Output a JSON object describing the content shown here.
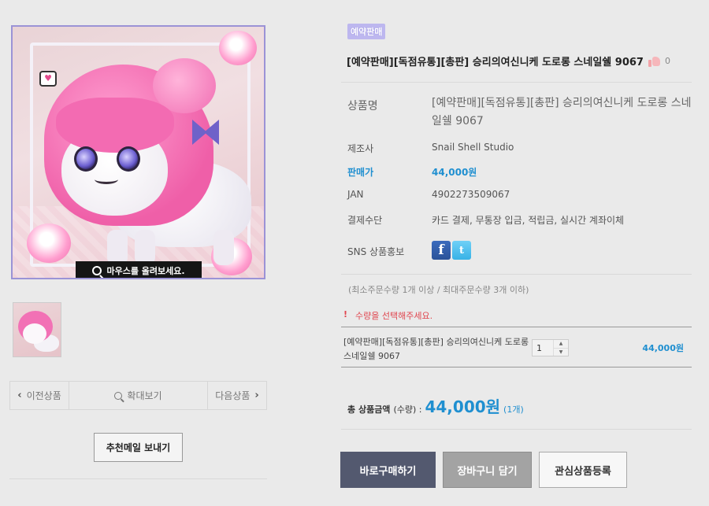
{
  "image": {
    "hover_hint": "마우스를 올려보세요."
  },
  "nav": {
    "prev": "이전상품",
    "zoom": "확대보기",
    "next": "다음상품"
  },
  "recommend_button": "추천메일 보내기",
  "product": {
    "badge": "예약판매",
    "title": "[예약판매][독점유통][총판] 승리의여신니케 도로롱 스네일쉘 9067",
    "like_count": "0"
  },
  "specs": {
    "name_label": "상품명",
    "name_value": "[예약판매][독점유통][총판] 승리의여신니케 도로롱 스네일쉘 9067",
    "maker_label": "제조사",
    "maker_value": "Snail Shell Studio",
    "price_label": "판매가",
    "price_value": "44,000원",
    "jan_label": "JAN",
    "jan_value": "4902273509067",
    "payment_label": "결제수단",
    "payment_value": "카드 결제, 무통장 입금, 적립금, 실시간 계좌이체",
    "sns_label": "SNS 상품홍보"
  },
  "order": {
    "limit_note": "(최소주문수량 1개 이상 / 최대주문수량 3개 이하)",
    "warn_mark": "!",
    "warn_text": "수량을 선택해주세요.",
    "option_name": "[예약판매][독점유통][총판] 승리의여신니케 도로롱 스네일쉘 9067",
    "quantity": "1",
    "option_price": "44,000원"
  },
  "total": {
    "label": "총 상품금액",
    "qty_label": "(수량) :",
    "amount": "44,000원",
    "count": "(1개)"
  },
  "buttons": {
    "buy": "바로구매하기",
    "cart": "장바구니 담기",
    "wish": "관심상품등록"
  },
  "colors": {
    "accent_blue": "#1f8fd0",
    "buy_button": "#53596f",
    "warning_red": "#e0464f"
  }
}
